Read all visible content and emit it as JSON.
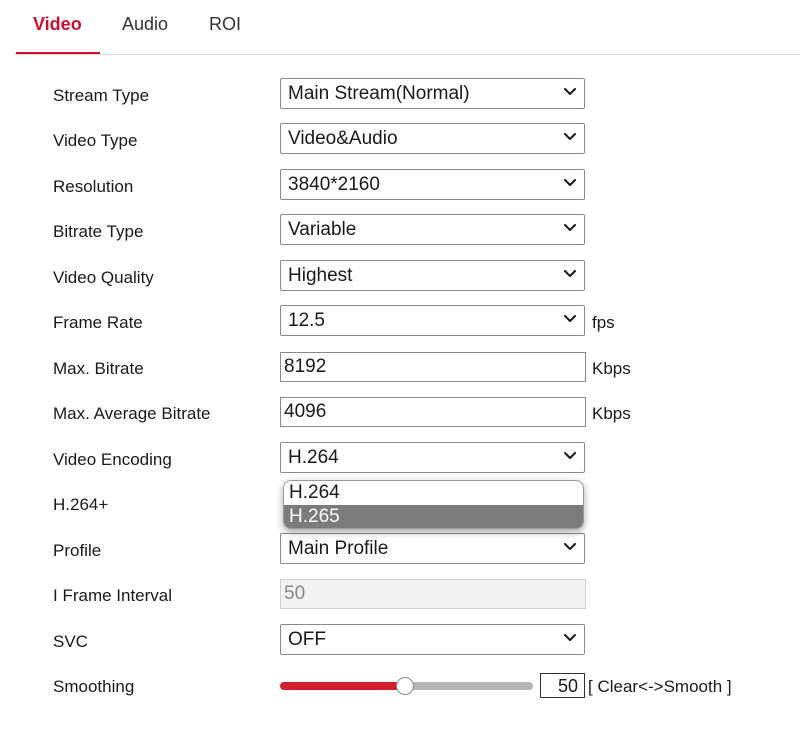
{
  "tabs": [
    {
      "label": "Video",
      "active": true
    },
    {
      "label": "Audio",
      "active": false
    },
    {
      "label": "ROI",
      "active": false
    }
  ],
  "accent_color": "#c8102e",
  "form": {
    "stream_type": {
      "label": "Stream Type",
      "value": "Main Stream(Normal)"
    },
    "video_type": {
      "label": "Video Type",
      "value": "Video&Audio"
    },
    "resolution": {
      "label": "Resolution",
      "value": "3840*2160"
    },
    "bitrate_type": {
      "label": "Bitrate Type",
      "value": "Variable"
    },
    "video_quality": {
      "label": "Video Quality",
      "value": "Highest"
    },
    "frame_rate": {
      "label": "Frame Rate",
      "value": "12.5",
      "unit": "fps"
    },
    "max_bitrate": {
      "label": "Max. Bitrate",
      "value": "8192",
      "unit": "Kbps"
    },
    "max_avg_bitrate": {
      "label": "Max. Average Bitrate",
      "value": "4096",
      "unit": "Kbps"
    },
    "video_encoding": {
      "label": "Video Encoding",
      "value": "H.264",
      "open_options": [
        "H.264",
        "H.265"
      ],
      "highlighted_option": "H.265"
    },
    "h264_plus": {
      "label": "H.264+"
    },
    "profile": {
      "label": "Profile",
      "value": "Main Profile"
    },
    "i_frame_interval": {
      "label": "I Frame Interval",
      "value": "50",
      "disabled": true
    },
    "svc": {
      "label": "SVC",
      "value": "OFF"
    },
    "smoothing": {
      "label": "Smoothing",
      "value": "50",
      "hint": "[ Clear<->Smooth ]",
      "fraction": 0.5
    }
  }
}
